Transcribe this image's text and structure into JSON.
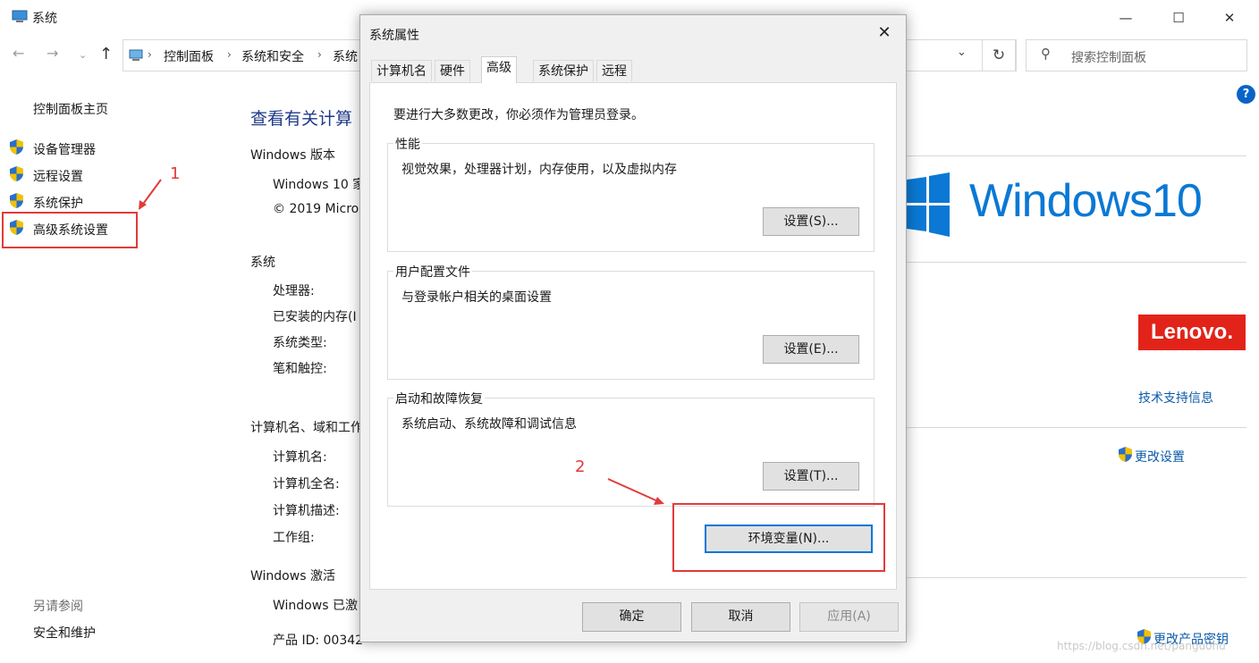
{
  "window": {
    "title": "系统"
  },
  "address": {
    "crumbs": [
      "控制面板",
      "系统和安全",
      "系统"
    ]
  },
  "search": {
    "placeholder": "搜索控制面板"
  },
  "sidebar": {
    "home": "控制面板主页",
    "items": [
      "设备管理器",
      "远程设置",
      "系统保护",
      "高级系统设置"
    ],
    "see_also_title": "另请参阅",
    "see_also_item": "安全和维护"
  },
  "main": {
    "heading": "查看有关计算",
    "win_edition_title": "Windows 版本",
    "win_edition_values": [
      "Windows 10 家",
      "© 2019 Micro"
    ],
    "system_title": "系统",
    "system_labels": [
      "处理器:",
      "已安装的内存(I",
      "系统类型:",
      "笔和触控:"
    ],
    "computer_title": "计算机名、域和工作",
    "computer_labels": [
      "计算机名:",
      "计算机全名:",
      "计算机描述:",
      "工作组:"
    ],
    "activation_title": "Windows 激活",
    "activation_status": "Windows 已激",
    "product_id": "产品 ID: 00342"
  },
  "right": {
    "windows_logo_text": "Windows10",
    "lenovo_text": "Lenovo.",
    "support_link": "技术支持信息",
    "change_settings": "更改设置",
    "change_key": "更改产品密钥",
    "watermark": "https://blog.csdn.net/panguohu"
  },
  "dialog": {
    "title": "系统属性",
    "tabs": [
      "计算机名",
      "硬件",
      "高级",
      "系统保护",
      "远程"
    ],
    "active_tab": "高级",
    "admin_note": "要进行大多数更改，你必须作为管理员登录。",
    "groups": [
      {
        "title": "性能",
        "desc": "视觉效果，处理器计划，内存使用，以及虚拟内存",
        "button": "设置(S)..."
      },
      {
        "title": "用户配置文件",
        "desc": "与登录帐户相关的桌面设置",
        "button": "设置(E)..."
      },
      {
        "title": "启动和故障恢复",
        "desc": "系统启动、系统故障和调试信息",
        "button": "设置(T)..."
      }
    ],
    "env_button": "环境变量(N)...",
    "ok": "确定",
    "cancel": "取消",
    "apply": "应用(A)"
  },
  "annotations": {
    "one": "1",
    "two": "2",
    "color": "#e23a3a"
  },
  "colors": {
    "accent": "#0078d7",
    "windows_blue": "#0a78d4",
    "lenovo": "#e2231a",
    "link": "#0b5aa8"
  }
}
